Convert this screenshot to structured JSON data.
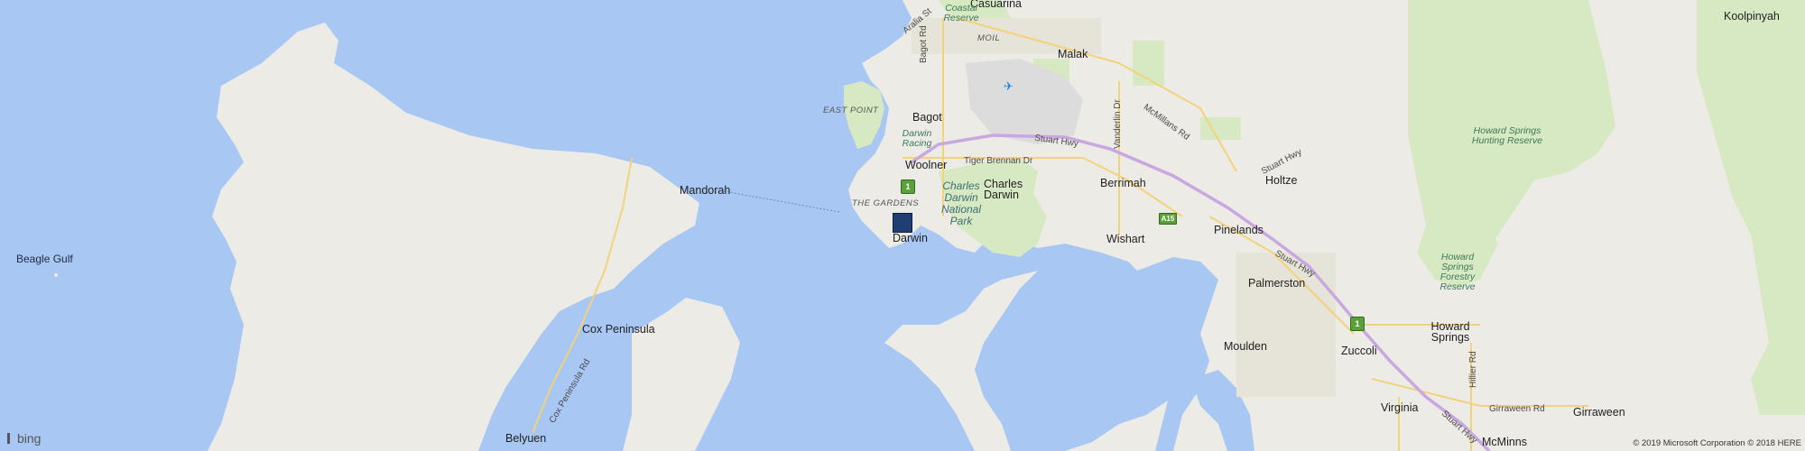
{
  "map": {
    "water_color": "#a8c7f2",
    "land_color": "#ecebe6",
    "park_color": "#d6e9c2",
    "airport_color": "#dcdcdc",
    "highway_color": "#c9a7e0",
    "road_color": "#f5dc8a"
  },
  "places": {
    "casuarina": "Casuarina",
    "malak": "Malak",
    "koolpinyah": "Koolpinyah",
    "bagot": "Bagot",
    "woolner": "Woolner",
    "charles_darwin": "Charles\nDarwin",
    "berrimah": "Berrimah",
    "holtze": "Holtze",
    "mandorah": "Mandorah",
    "darwin": "Darwin",
    "wishart": "Wishart",
    "pinelands": "Pinelands",
    "palmerston": "Palmerston",
    "moulden": "Moulden",
    "zuccoli": "Zuccoli",
    "howard_springs": "Howard\nSprings",
    "cox_peninsula": "Cox Peninsula",
    "virginia": "Virginia",
    "girraween": "Girraween",
    "belyuen": "Belyuen",
    "mcminns": "McMinns",
    "beagle_gulf": "Beagle Gulf"
  },
  "areas": {
    "east_point": "EAST POINT",
    "the_gardens": "THE GARDENS",
    "moil": "MOIL",
    "darwin_racing": "Darwin\nRacing",
    "coastal_reserve": "Coastal\nReserve",
    "charles_darwin_np": "Charles\nDarwin\nNational\nPark",
    "hunting_reserve": "Howard Springs\nHunting Reserve",
    "forestry_reserve": "Howard\nSprings\nForestry\nReserve"
  },
  "roads": {
    "stuart_hwy_1": "Stuart Hwy",
    "stuart_hwy_2": "Stuart Hwy",
    "stuart_hwy_3": "Stuart Hwy",
    "stuart_hwy_4": "Stuart Hwy",
    "tiger_brennan": "Tiger Brennan Dr",
    "bagot_rd": "Bagot Rd",
    "vanderlin": "Vanderlin Dr",
    "mcmillans": "McMillans Rd",
    "cox_peninsula_rd": "Cox Peninsula Rd",
    "girraween_rd": "Girraween Rd",
    "hillier_rd": "Hillier Rd",
    "aralia_st": "Aralia St"
  },
  "shields": {
    "route1_a": "1",
    "route1_b": "1",
    "a15": "A15"
  },
  "branding": {
    "logo_text": "bing",
    "copyright": "© 2019 Microsoft Corporation © 2018 HERE"
  }
}
